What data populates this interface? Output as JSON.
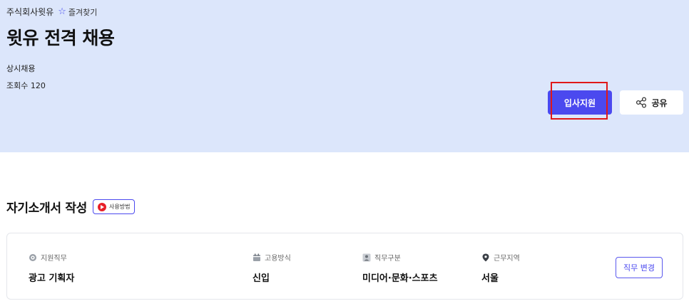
{
  "header": {
    "company": "주식회사윗유",
    "favorite_label": "즐겨찾기",
    "title": "윗유 전격 채용",
    "hire_type": "상시채용",
    "views": "조회수 120",
    "apply_label": "입사지원",
    "share_label": "공유"
  },
  "cover_letter": {
    "title": "자기소개서 작성",
    "howto_label": "사용방법"
  },
  "job_info": {
    "fields": [
      {
        "label": "지원직무",
        "value": "광고 기획자",
        "icon": "target-icon"
      },
      {
        "label": "고용방식",
        "value": "신입",
        "icon": "calendar-icon"
      },
      {
        "label": "직무구분",
        "value": "미디어·문화·스포츠",
        "icon": "person-icon"
      },
      {
        "label": "근무지역",
        "value": "서울",
        "icon": "location-pin-icon"
      }
    ],
    "change_label": "직무 변경"
  },
  "colors": {
    "hero_bg": "#dce6fb",
    "accent": "#4b49ef",
    "highlight": "#e01818"
  }
}
